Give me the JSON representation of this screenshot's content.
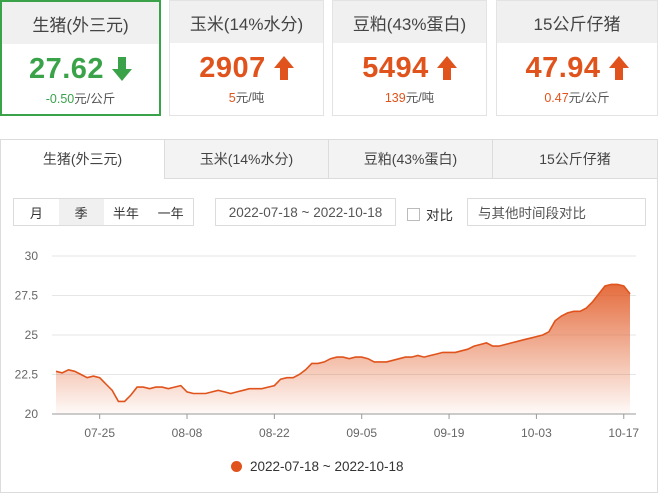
{
  "cards": [
    {
      "title": "生猪(外三元)",
      "value": "27.62",
      "dir": "down",
      "amount": "-0.50",
      "unit": "元/公斤"
    },
    {
      "title": "玉米(14%水分)",
      "value": "2907",
      "dir": "up",
      "amount": "5",
      "unit": "元/吨"
    },
    {
      "title": "豆粕(43%蛋白)",
      "value": "5494",
      "dir": "up",
      "amount": "139",
      "unit": "元/吨"
    },
    {
      "title": "15公斤仔猪",
      "value": "47.94",
      "dir": "up",
      "amount": "0.47",
      "unit": "元/公斤"
    }
  ],
  "tabs": [
    "生猪(外三元)",
    "玉米(14%水分)",
    "豆粕(43%蛋白)",
    "15公斤仔猪"
  ],
  "controls": {
    "periods": [
      "月",
      "季",
      "半年",
      "一年"
    ],
    "active_period": "季",
    "date_range": "2022-07-18 ~ 2022-10-18",
    "compare_label": "对比",
    "compare_placeholder": "与其他时间段对比"
  },
  "colors": {
    "up": "#e0531c",
    "down": "#3aa34a",
    "line": "#e0531c"
  },
  "chart_data": {
    "type": "area",
    "legend": "2022-07-18 ~ 2022-10-18",
    "legend_position": "bottom",
    "x_ticks": [
      "07-25",
      "08-08",
      "08-22",
      "09-05",
      "09-19",
      "10-03",
      "10-17"
    ],
    "y_ticks": [
      "20",
      "22.5",
      "25",
      "27.5",
      "30"
    ],
    "ylim": [
      20,
      30
    ],
    "grid": "horizontal",
    "x": [
      "07-18",
      "07-19",
      "07-20",
      "07-21",
      "07-22",
      "07-23",
      "07-24",
      "07-25",
      "07-26",
      "07-27",
      "07-28",
      "07-29",
      "07-30",
      "07-31",
      "08-01",
      "08-02",
      "08-03",
      "08-04",
      "08-05",
      "08-06",
      "08-07",
      "08-08",
      "08-09",
      "08-10",
      "08-11",
      "08-12",
      "08-13",
      "08-14",
      "08-15",
      "08-16",
      "08-17",
      "08-18",
      "08-19",
      "08-20",
      "08-21",
      "08-22",
      "08-23",
      "08-24",
      "08-25",
      "08-26",
      "08-27",
      "08-28",
      "08-29",
      "08-30",
      "08-31",
      "09-01",
      "09-02",
      "09-03",
      "09-04",
      "09-05",
      "09-06",
      "09-07",
      "09-08",
      "09-09",
      "09-10",
      "09-11",
      "09-12",
      "09-13",
      "09-14",
      "09-15",
      "09-16",
      "09-17",
      "09-18",
      "09-19",
      "09-20",
      "09-21",
      "09-22",
      "09-23",
      "09-24",
      "09-25",
      "09-26",
      "09-27",
      "09-28",
      "09-29",
      "09-30",
      "10-01",
      "10-02",
      "10-03",
      "10-04",
      "10-05",
      "10-06",
      "10-07",
      "10-08",
      "10-09",
      "10-10",
      "10-11",
      "10-12",
      "10-13",
      "10-14",
      "10-15",
      "10-16",
      "10-17",
      "10-18"
    ],
    "values": [
      22.7,
      22.6,
      22.8,
      22.7,
      22.5,
      22.3,
      22.4,
      22.3,
      21.9,
      21.5,
      20.8,
      20.8,
      21.2,
      21.7,
      21.7,
      21.6,
      21.7,
      21.7,
      21.6,
      21.7,
      21.8,
      21.4,
      21.3,
      21.3,
      21.3,
      21.4,
      21.5,
      21.4,
      21.3,
      21.4,
      21.5,
      21.6,
      21.6,
      21.6,
      21.7,
      21.8,
      22.2,
      22.3,
      22.3,
      22.5,
      22.8,
      23.2,
      23.2,
      23.3,
      23.5,
      23.6,
      23.6,
      23.5,
      23.6,
      23.6,
      23.5,
      23.3,
      23.3,
      23.3,
      23.4,
      23.5,
      23.6,
      23.6,
      23.7,
      23.6,
      23.7,
      23.8,
      23.9,
      23.9,
      23.9,
      24.0,
      24.1,
      24.3,
      24.4,
      24.5,
      24.3,
      24.3,
      24.4,
      24.5,
      24.6,
      24.7,
      24.8,
      24.9,
      25.0,
      25.2,
      25.9,
      26.2,
      26.4,
      26.5,
      26.5,
      26.7,
      27.1,
      27.6,
      28.1,
      28.2,
      28.2,
      28.1,
      27.6
    ]
  }
}
